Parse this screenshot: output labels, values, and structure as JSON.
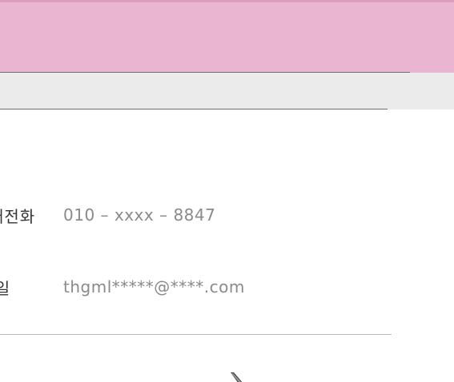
{
  "header": {
    "band_color": "#eab5d0",
    "accent_color": "#dd9fbb"
  },
  "subheader": {
    "band_color": "#ebebeb"
  },
  "contact": {
    "phone_label": "대전화",
    "phone_value": "010 – xxxx – 8847",
    "email_label": "|일",
    "email_value": "thgml*****@****.com"
  },
  "icons": {
    "edit": "pencil-icon"
  }
}
